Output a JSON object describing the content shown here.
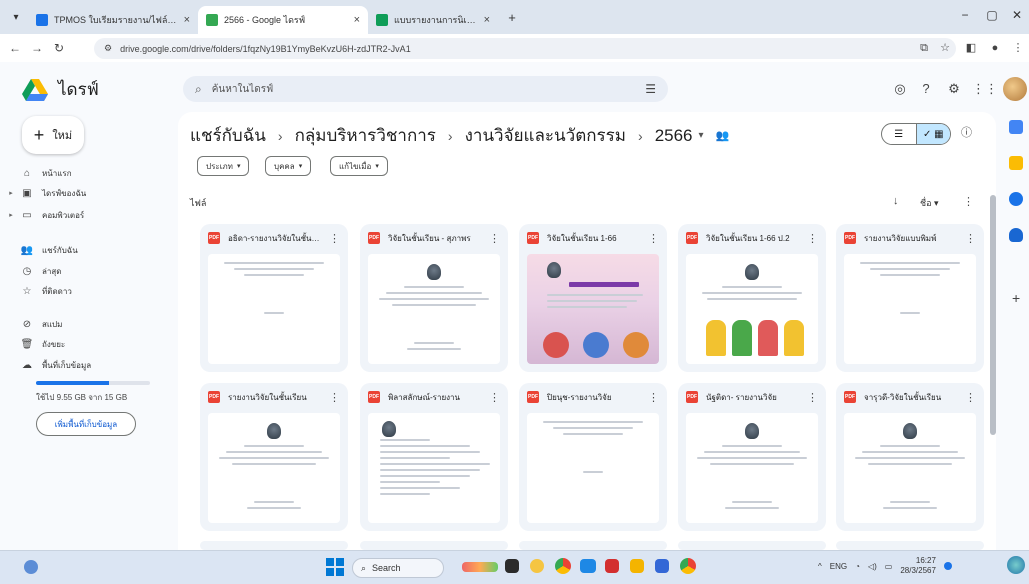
{
  "browser": {
    "tabs": [
      {
        "title": "TPMOS ใบเรียมรายงาน/ไฟล์ The",
        "active": false,
        "favicon_color": "#1a73e8"
      },
      {
        "title": "2566 - Google ไดรฟ์",
        "active": true,
        "favicon_color": "#34a853"
      },
      {
        "title": "แบบรายงานการนิเทศ - Google ชีต",
        "active": false,
        "favicon_color": "#0f9d58"
      }
    ],
    "new_tab_label": "+",
    "address": "drive.google.com/drive/folders/1fqzNy19B1YmyBeKvzU6H-zdJTR2-JvA1"
  },
  "drive": {
    "app_title": "ไดรฟ์",
    "search_placeholder": "ค้นหาในไดรฟ์",
    "new_label": "ใหม่",
    "nav": [
      {
        "label": "หน้าแรก",
        "icon": "home-icon"
      },
      {
        "label": "ไดรฟ์ของฉัน",
        "icon": "drive-icon"
      },
      {
        "label": "คอมพิวเตอร์",
        "icon": "computer-icon"
      },
      {
        "label": "แชร์กับฉัน",
        "icon": "shared-icon"
      },
      {
        "label": "ล่าสุด",
        "icon": "clock-icon"
      },
      {
        "label": "ที่ติดดาว",
        "icon": "star-icon"
      },
      {
        "label": "สแปม",
        "icon": "spam-icon"
      },
      {
        "label": "ถังขยะ",
        "icon": "trash-icon"
      },
      {
        "label": "พื้นที่เก็บข้อมูล",
        "icon": "cloud-icon"
      }
    ],
    "storage": {
      "text": "ใช้ไป 9.55 GB จาก 15 GB",
      "used_fraction": 0.64
    },
    "buy_storage_label": "เพิ่มพื้นที่เก็บข้อมูล",
    "breadcrumb": [
      "แชร์กับฉัน",
      "กลุ่มบริหารวิชาการ",
      "งานวิจัยและนวัตกรรม",
      "2566"
    ],
    "filters": [
      "ประเภท",
      "บุคคล",
      "แก้ไขเมื่อ"
    ],
    "files_label": "ไฟล์",
    "sort_label": "ชื่อ",
    "files": [
      {
        "name": "อธิดา-รายงานวิจัยในชั้นเรียน",
        "thumb": "text"
      },
      {
        "name": "วิจัยในชั้นเรียน - สุภาพร",
        "thumb": "seal"
      },
      {
        "name": "วิจัยในชั้นเรียน 1-66",
        "thumb": "photo"
      },
      {
        "name": "วิจัยในชั้นเรียน 1-66 ป.2",
        "thumb": "cartoon"
      },
      {
        "name": "รายงานวิจัยแบบพิมพ์",
        "thumb": "text"
      },
      {
        "name": "รายงานวิจัยในชั้นเรียน",
        "thumb": "seal"
      },
      {
        "name": "พิลาสลักษณ์-รายงาน",
        "thumb": "form"
      },
      {
        "name": "ปิยนุช-รายงานวิจัย",
        "thumb": "text"
      },
      {
        "name": "นัฐติดา- รายงานวิจัย",
        "thumb": "seal"
      },
      {
        "name": "จารุวดี-วิจัยในชั้นเรียน",
        "thumb": "seal"
      }
    ]
  },
  "taskbar": {
    "search_label": "Search",
    "lang": "ENG",
    "time": "16:27",
    "date": "28/3/2567"
  }
}
